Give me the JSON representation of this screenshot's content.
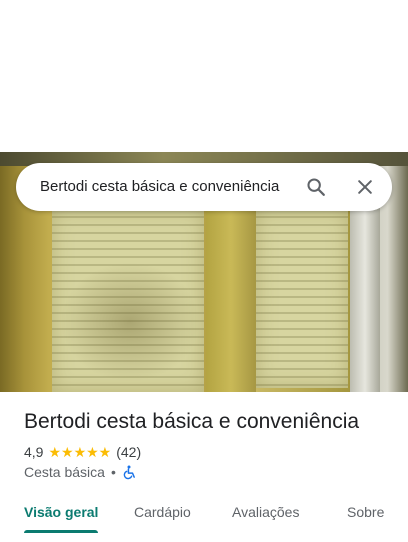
{
  "search": {
    "query": "Bertodi cesta básica e conveniência",
    "search_icon": "search-icon",
    "close_icon": "close-icon"
  },
  "place": {
    "name": "Bertodi cesta básica e conveniência",
    "rating": "4,9",
    "stars": "★★★★★",
    "review_count": "(42)",
    "category": "Cesta básica",
    "separator": "•",
    "accessibility_icon": "wheelchair-accessible-icon"
  },
  "tabs": [
    {
      "label": "Visão geral",
      "active": true
    },
    {
      "label": "Cardápio",
      "active": false
    },
    {
      "label": "Avaliações",
      "active": false
    },
    {
      "label": "Sobre",
      "active": false
    }
  ],
  "colors": {
    "accent": "#0b7b70",
    "star": "#fbbc04",
    "accessibility": "#1a73e8"
  }
}
